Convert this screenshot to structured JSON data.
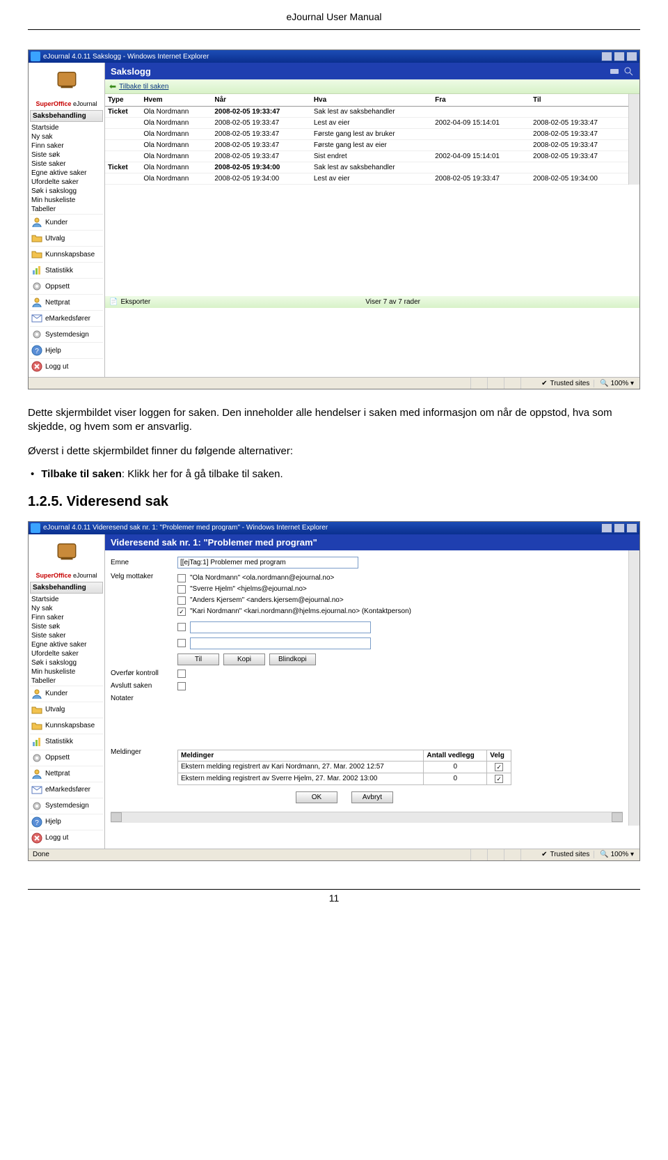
{
  "header": "eJournal User Manual",
  "pagenum": "11",
  "para1": "Dette skjermbildet viser loggen for saken. Den inneholder alle hendelser i saken med informasjon om når de oppstod, hva som skjedde, og hvem som er ansvarlig.",
  "para2": "Øverst i dette skjermbildet finner du følgende alternativer:",
  "bullet_bold": "Tilbake til saken",
  "bullet_rest": ": Klikk her for å gå tilbake til saken.",
  "section_heading": "1.2.5. Videresend sak",
  "sidebar": {
    "brand_so": "SuperOffice",
    "brand_ej": " eJournal",
    "sakshead": "Saksbehandling",
    "items": [
      "Startside",
      "Ny sak",
      "Finn saker",
      "Siste søk",
      "Siste saker",
      "Egne aktive saker",
      "Ufordelte saker",
      "Søk i sakslogg",
      "Min huskeliste",
      "Tabeller"
    ],
    "lower": [
      "Kunder",
      "Utvalg",
      "Kunnskapsbase",
      "Statistikk",
      "Oppsett",
      "Nettprat",
      "eMarkedsfører",
      "Systemdesign",
      "Hjelp",
      "Logg ut"
    ]
  },
  "lower_icons": [
    "user",
    "folder",
    "folder",
    "chart",
    "gear",
    "user",
    "mail",
    "gear",
    "help",
    "close"
  ],
  "app1": {
    "window_title": "eJournal 4.0.11 Sakslogg - Windows Internet Explorer",
    "title": "Sakslogg",
    "crumb": "Tilbake til saken",
    "cols": [
      "Type",
      "Hvem",
      "Når",
      "Hva",
      "Fra",
      "Til"
    ],
    "rows": [
      [
        "Ticket",
        "Ola Nordmann",
        "2008-02-05 19:33:47",
        "Sak lest av saksbehandler",
        "",
        ""
      ],
      [
        "",
        "Ola Nordmann",
        "2008-02-05 19:33:47",
        "Lest av eier",
        "2002-04-09 15:14:01",
        "2008-02-05 19:33:47"
      ],
      [
        "",
        "Ola Nordmann",
        "2008-02-05 19:33:47",
        "Første gang lest av bruker",
        "",
        "2008-02-05 19:33:47"
      ],
      [
        "",
        "Ola Nordmann",
        "2008-02-05 19:33:47",
        "Første gang lest av eier",
        "",
        "2008-02-05 19:33:47"
      ],
      [
        "",
        "Ola Nordmann",
        "2008-02-05 19:33:47",
        "Sist endret",
        "2002-04-09 15:14:01",
        "2008-02-05 19:33:47"
      ],
      [
        "Ticket",
        "Ola Nordmann",
        "2008-02-05 19:34:00",
        "Sak lest av saksbehandler",
        "",
        ""
      ],
      [
        "",
        "Ola Nordmann",
        "2008-02-05 19:34:00",
        "Lest av eier",
        "2008-02-05 19:33:47",
        "2008-02-05 19:34:00"
      ]
    ],
    "export": "Eksporter",
    "viser": "Viser 7 av 7 rader",
    "trusted": "Trusted sites",
    "zoom": "100%"
  },
  "app2": {
    "window_title": "eJournal 4.0.11 Videresend sak nr. 1: \"Problemer med program\" - Windows Internet Explorer",
    "title": "Videresend sak nr. 1: \"Problemer med program\"",
    "emne_label": "Emne",
    "emne_value": "[[ejTag:1] Problemer med program",
    "mottaker_label": "Velg mottaker",
    "recipients": [
      {
        "name": "\"Ola Nordmann\" <ola.nordmann@ejournal.no>",
        "checked": false
      },
      {
        "name": "\"Sverre Hjelm\" <hjelms@ejournal.no>",
        "checked": false
      },
      {
        "name": "\"Anders Kjersem\" <anders.kjersem@ejournal.no>",
        "checked": false
      },
      {
        "name": "\"Kari Nordmann\" <kari.nordmann@hjelms.ejournal.no> (Kontaktperson)",
        "checked": true
      }
    ],
    "btn_til": "Til",
    "btn_kopi": "Kopi",
    "btn_blind": "Blindkopi",
    "overfor": "Overfør kontroll",
    "avslutt": "Avslutt saken",
    "notater": "Notater",
    "meldinger_label": "Meldinger",
    "msg_cols": [
      "Meldinger",
      "Antall vedlegg",
      "Velg"
    ],
    "msg_rows": [
      [
        "Ekstern melding registrert av Kari Nordmann, 27. Mar. 2002 12:57",
        "0",
        true
      ],
      [
        "Ekstern melding registrert av Sverre Hjelm, 27. Mar. 2002 13:00",
        "0",
        true
      ]
    ],
    "ok": "OK",
    "cancel": "Avbryt",
    "done": "Done",
    "trusted": "Trusted sites",
    "zoom": "100%"
  }
}
